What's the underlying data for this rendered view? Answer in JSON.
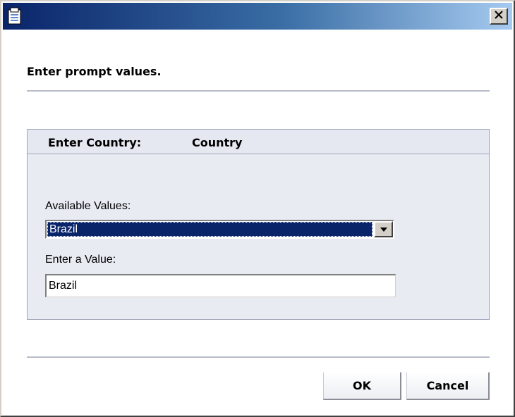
{
  "window": {
    "icon": "document-icon",
    "close_icon": "close-icon"
  },
  "dialog": {
    "heading": "Enter prompt values."
  },
  "prompt": {
    "label": "Enter Country:",
    "parameter": "Country",
    "available_values_label": "Available Values:",
    "selected_value": "Brazil",
    "enter_value_label": "Enter a Value:",
    "entered_value": "Brazil"
  },
  "buttons": {
    "ok": "OK",
    "cancel": "Cancel"
  },
  "colors": {
    "titlebar_start": "#0a246a",
    "titlebar_end": "#a6caf0",
    "selection": "#0a246a",
    "panel_bg": "#e9ebf3"
  }
}
